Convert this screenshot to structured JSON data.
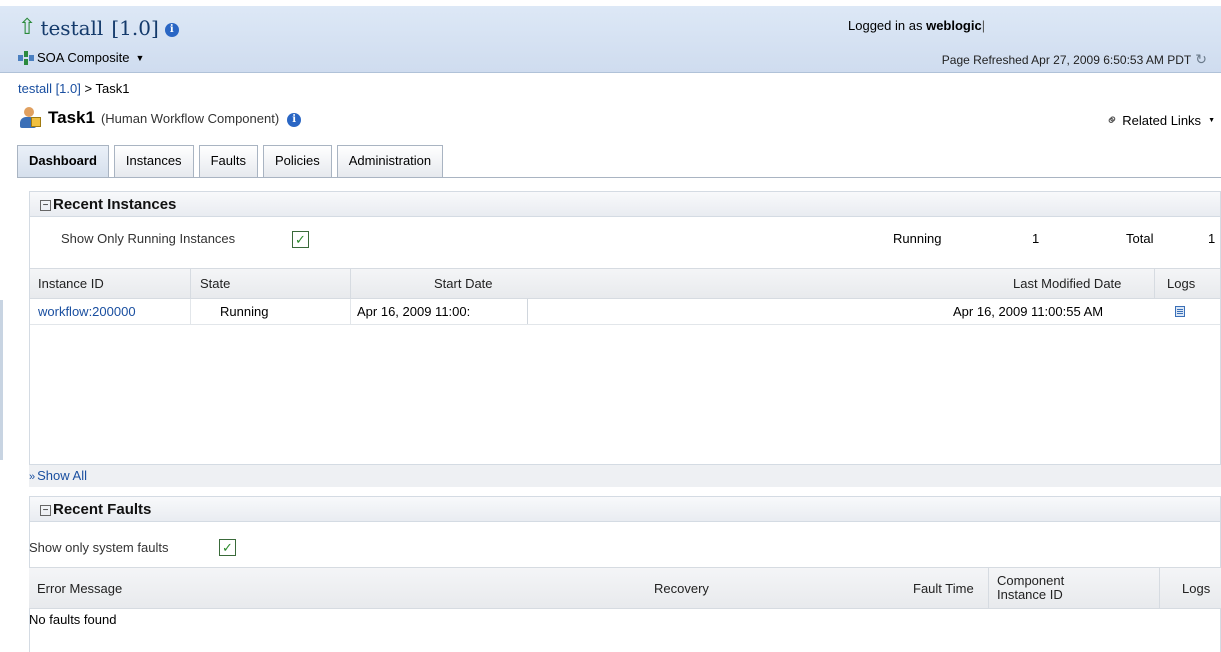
{
  "header": {
    "app_title": "testall",
    "app_version": "[1.0]",
    "soa_menu_label": "SOA Composite",
    "logged_in_prefix": "Logged in as",
    "logged_in_user": "weblogic",
    "page_refreshed": "Page Refreshed Apr 27, 2009 6:50:53 AM PDT"
  },
  "breadcrumb": {
    "link": "testall [1.0]",
    "separator": ">",
    "current": "Task1"
  },
  "component": {
    "name": "Task1",
    "type": "(Human Workflow Component)",
    "related_links": "Related Links"
  },
  "tabs": [
    {
      "label": "Dashboard",
      "active": true
    },
    {
      "label": "Instances",
      "active": false
    },
    {
      "label": "Faults",
      "active": false
    },
    {
      "label": "Policies",
      "active": false
    },
    {
      "label": "Administration",
      "active": false
    }
  ],
  "recent_instances": {
    "title": "Recent Instances",
    "show_only_running_label": "Show Only Running Instances",
    "show_only_running_checked": true,
    "running_label": "Running",
    "running_count": "1",
    "total_label": "Total",
    "total_count": "1",
    "columns": [
      "Instance ID",
      "State",
      "Start Date",
      "Last Modified Date",
      "Logs"
    ],
    "rows": [
      {
        "instance_id": "workflow:200000",
        "state": "Running",
        "start_date": "Apr 16, 2009 11:00:",
        "last_modified": "Apr 16, 2009 11:00:55 AM",
        "logs_icon": "log-icon"
      }
    ],
    "show_all": "Show All"
  },
  "recent_faults": {
    "title": "Recent Faults",
    "show_only_system_label": "Show only system faults",
    "show_only_system_checked": true,
    "columns": {
      "error_message": "Error Message",
      "recovery": "Recovery",
      "fault_time": "Fault Time",
      "component_instance_id_1": "Component",
      "component_instance_id_2": "Instance ID",
      "logs": "Logs"
    },
    "empty_message": "No faults found"
  },
  "colors": {
    "header_bg": "#d6e2f2",
    "link": "#1a4fa0",
    "title": "#143a6b"
  }
}
